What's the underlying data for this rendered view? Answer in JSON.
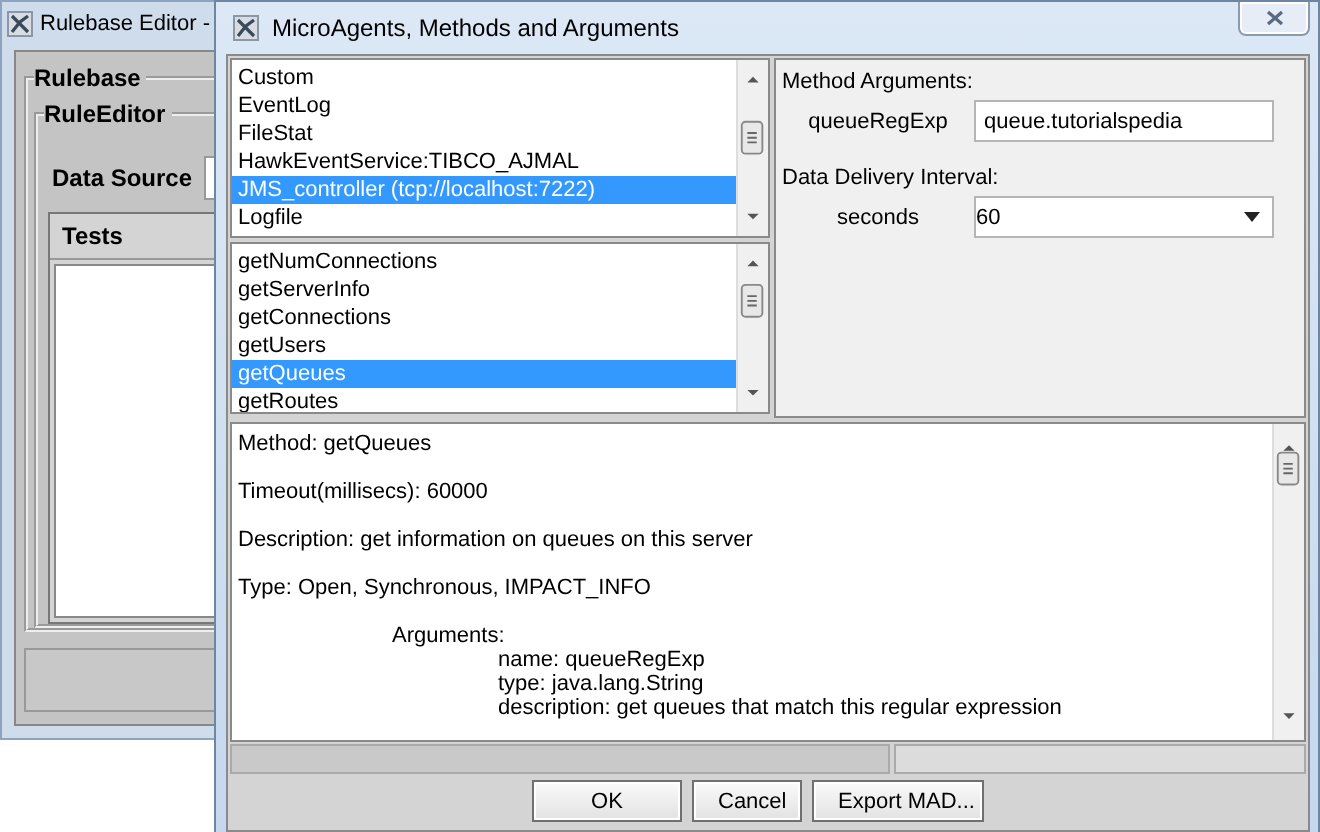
{
  "background_window": {
    "title": "Rulebase Editor -",
    "groups": [
      "Rulebase",
      "RuleEditor"
    ],
    "data_source_label": "Data Source",
    "tests_header": "Tests"
  },
  "dialog": {
    "title": "MicroAgents, Methods and Arguments",
    "microagents": [
      {
        "label": "Custom",
        "selected": false
      },
      {
        "label": "EventLog",
        "selected": false
      },
      {
        "label": "FileStat",
        "selected": false
      },
      {
        "label": "HawkEventService:TIBCO_AJMAL",
        "selected": false
      },
      {
        "label": "JMS_controller (tcp://localhost:7222)",
        "selected": true
      },
      {
        "label": "Logfile",
        "selected": false
      }
    ],
    "methods": [
      {
        "label": "getNumConnections",
        "selected": false
      },
      {
        "label": "getServerInfo",
        "selected": false
      },
      {
        "label": "getConnections",
        "selected": false
      },
      {
        "label": "getUsers",
        "selected": false
      },
      {
        "label": "getQueues",
        "selected": true
      },
      {
        "label": "getRoutes",
        "selected": false
      }
    ],
    "method_arguments": {
      "heading": "Method Arguments:",
      "fields": [
        {
          "label": "queueRegExp",
          "value": "queue.tutorialspedia"
        }
      ]
    },
    "data_delivery": {
      "heading": "Data Delivery Interval:",
      "label": "seconds",
      "value": "60"
    },
    "details": [
      {
        "kind": "line",
        "text": "Method: getQueues"
      },
      {
        "kind": "line",
        "text": "Timeout(millisecs): 60000"
      },
      {
        "kind": "line",
        "text": "Description: get information on queues on this server"
      },
      {
        "kind": "line",
        "text": "Type: Open, Synchronous, IMPACT_INFO"
      },
      {
        "kind": "section",
        "text": "Arguments:"
      },
      {
        "kind": "attribute",
        "text": "name: queueRegExp"
      },
      {
        "kind": "attribute",
        "text": "type: java.lang.String"
      },
      {
        "kind": "attribute",
        "text": "description: get queues that match this regular expression"
      }
    ],
    "buttons": [
      "OK",
      "Cancel",
      "Export MAD..."
    ]
  }
}
